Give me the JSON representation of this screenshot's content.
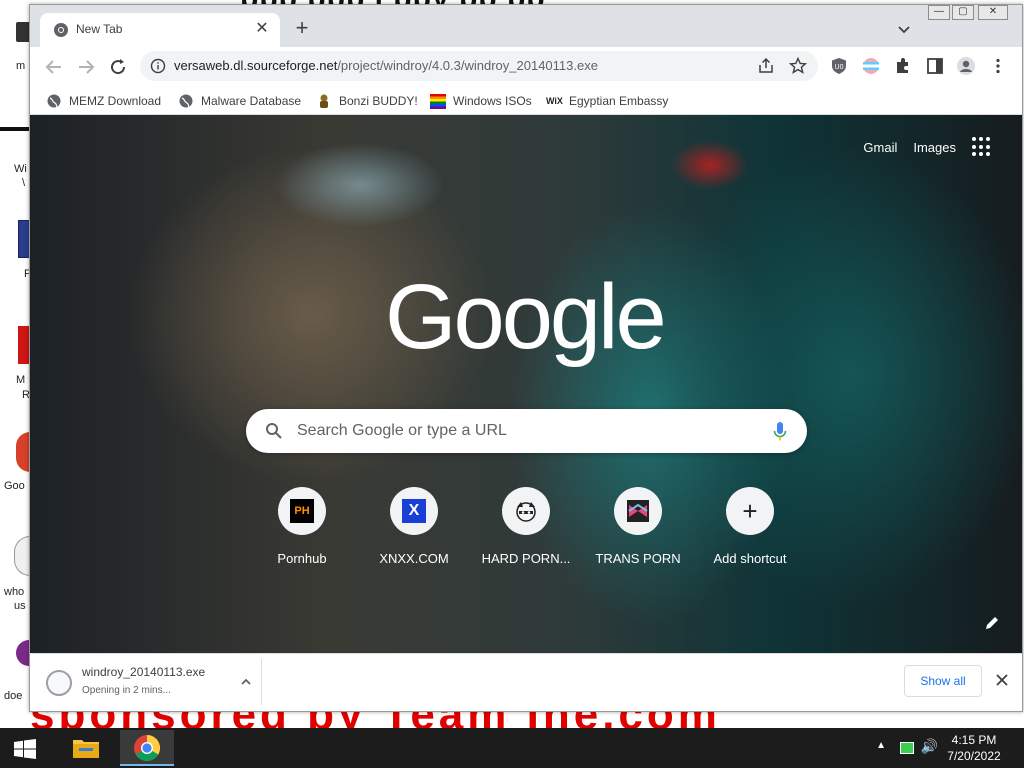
{
  "desktop": {
    "top_banner": "ppp ppp j ppy pp pp",
    "bottom_banner": "sponsored by Team Ine.com",
    "labels": [
      "m",
      "Wi",
      "\\",
      "F",
      "M",
      "R",
      "Goo",
      "who",
      "us",
      "doe"
    ]
  },
  "browser": {
    "tab_title": "New Tab",
    "url_host": "versaweb.dl.sourceforge.net",
    "url_path": "/project/windroy/4.0.3/windroy_20140113.exe"
  },
  "bookmarks": [
    {
      "label": "MEMZ Download",
      "icon": "globe-icon"
    },
    {
      "label": "Malware Database",
      "icon": "globe-icon"
    },
    {
      "label": "Bonzi BUDDY!",
      "icon": "bonzi-icon"
    },
    {
      "label": "Windows ISOs",
      "icon": "rainbow-flag-icon"
    },
    {
      "label": "Egyptian Embassy",
      "icon": "wix-icon"
    }
  ],
  "ntp": {
    "gmail": "Gmail",
    "images": "Images",
    "logo": "Google",
    "search_placeholder": "Search Google or type a URL",
    "shortcuts": [
      {
        "label": "Pornhub",
        "icon": "PH"
      },
      {
        "label": "XNXX.COM",
        "icon": "X"
      },
      {
        "label": "HARD PORN...",
        "icon": "raccoon-icon"
      },
      {
        "label": "TRANS PORN",
        "icon": "trans-icon"
      },
      {
        "label": "Add shortcut",
        "icon": "+"
      }
    ]
  },
  "download": {
    "filename": "windroy_20140113.exe",
    "status": "Opening in 2 mins...",
    "show_all": "Show all"
  },
  "taskbar": {
    "time": "4:15 PM",
    "date": "7/20/2022"
  },
  "colors": {
    "accent": "#1a73e8",
    "taskbar": "#1c1c1c"
  }
}
